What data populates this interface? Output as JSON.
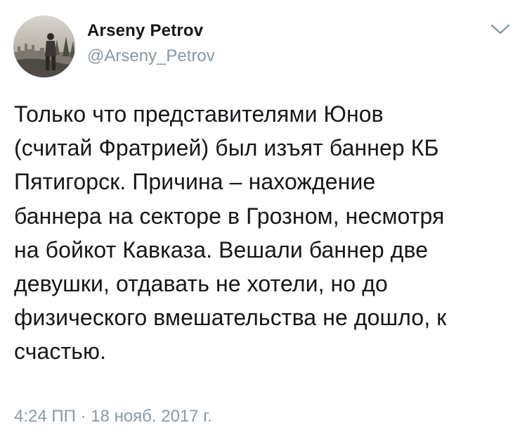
{
  "tweet": {
    "author": {
      "display_name": "Arseny Petrov",
      "handle": "@Arseny_Petrov",
      "avatar_icon": "avatar-photo"
    },
    "menu_icon": "chevron-down-icon",
    "text": "Только что представителями Юнов\n(считай Фратрией) был изъят баннер КБ\nПятигорск. Причина – нахождение\nбаннера на секторе в Грозном, несмотря\nна бойкот Кавказа. Вешали баннер две\nдевушки, отдавать не хотели, но до\nфизического вмешательства не дошло, к\nсчастью.",
    "timestamp": "4:24 ПП · 18 нояб. 2017 г."
  },
  "colors": {
    "text": "#14171a",
    "secondary": "#8899a6",
    "background": "#ffffff"
  }
}
